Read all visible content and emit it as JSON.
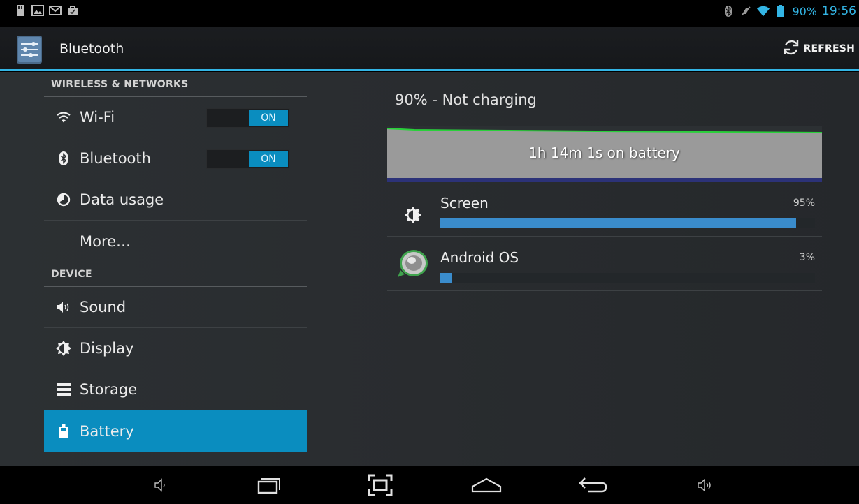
{
  "status_bar": {
    "left_icons": [
      "usb-icon",
      "picture-icon",
      "gmail-icon",
      "shopping-bag-icon"
    ],
    "right_icons": [
      "bluetooth-icon",
      "mute-icon",
      "wifi-icon",
      "battery-icon"
    ],
    "battery_text": "90%",
    "time": "19:56"
  },
  "action_bar": {
    "icon": "settings-icon",
    "title": "Bluetooth",
    "refresh_label": "REFRESH"
  },
  "settings": {
    "sections": [
      {
        "header": "WIRELESS & NETWORKS",
        "items": [
          {
            "label": "Wi-Fi",
            "icon": "wifi-icon",
            "toggle": "ON"
          },
          {
            "label": "Bluetooth",
            "icon": "bluetooth-icon",
            "toggle": "ON"
          },
          {
            "label": "Data usage",
            "icon": "data-usage-icon"
          },
          {
            "label": "More…"
          }
        ]
      },
      {
        "header": "DEVICE",
        "items": [
          {
            "label": "Sound",
            "icon": "speaker-icon"
          },
          {
            "label": "Display",
            "icon": "brightness-icon"
          },
          {
            "label": "Storage",
            "icon": "storage-icon"
          },
          {
            "label": "Battery",
            "icon": "battery-icon",
            "selected": true
          }
        ]
      }
    ]
  },
  "battery": {
    "status": "90% - Not charging",
    "graph_label": "1h 14m 1s on battery",
    "usage": [
      {
        "name": "Screen",
        "percent_label": "95%",
        "percent": 95,
        "icon": "brightness-icon"
      },
      {
        "name": "Android OS",
        "percent_label": "3%",
        "percent": 3,
        "icon": "android-os-icon"
      }
    ]
  },
  "nav_bar": {
    "buttons": [
      "volume-down-icon",
      "recent-apps-icon",
      "screenshot-icon",
      "home-icon",
      "back-icon",
      "volume-up-icon"
    ]
  },
  "colors": {
    "accent": "#33b5e5",
    "selected": "#0a8dbf",
    "usage_bar": "#3a8ccc"
  }
}
